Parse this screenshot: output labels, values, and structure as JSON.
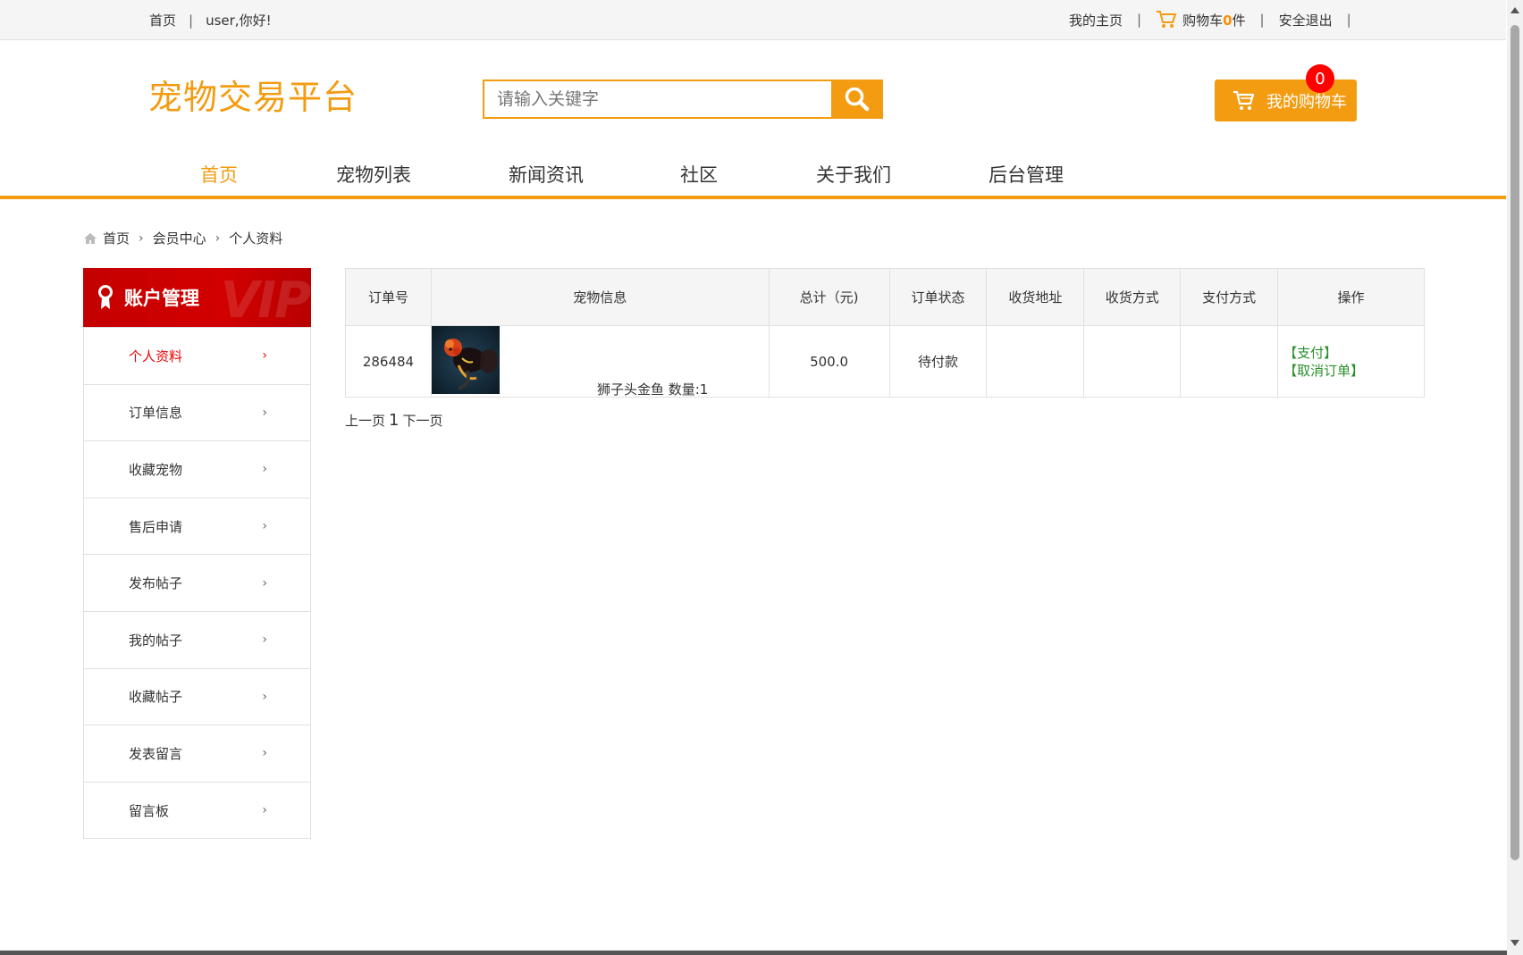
{
  "topbar": {
    "home": "首页",
    "greeting": "user,你好!",
    "my_home": "我的主页",
    "cart_prefix": "购物车",
    "cart_count": "0",
    "cart_suffix": "件",
    "logout": "安全退出",
    "sep": "|"
  },
  "header": {
    "logo": "宠物交易平台",
    "search_placeholder": "请输入关键字",
    "mycart_label": "我的购物车",
    "mycart_badge": "0"
  },
  "nav": [
    "首页",
    "宠物列表",
    "新闻资讯",
    "社区",
    "关于我们",
    "后台管理"
  ],
  "breadcrumb": [
    "首页",
    "会员中心",
    "个人资料"
  ],
  "sidebar": {
    "title": "账户管理",
    "watermark": "VIP",
    "items": [
      "个人资料",
      "订单信息",
      "收藏宠物",
      "售后申请",
      "发布帖子",
      "我的帖子",
      "收藏帖子",
      "发表留言",
      "留言板"
    ]
  },
  "orders": {
    "headers": [
      "订单号",
      "宠物信息",
      "总计（元)",
      "订单状态",
      "收货地址",
      "收货方式",
      "支付方式",
      "操作"
    ],
    "rows": [
      {
        "order_no": "286484",
        "pet_info": "狮子头金鱼 数量:1",
        "total": "500.0",
        "status": "待付款",
        "address": "",
        "delivery": "",
        "payment": "",
        "op_pay": "【支付】",
        "op_cancel": "【取消订单】"
      }
    ]
  },
  "pager": {
    "prev": "上一页",
    "page": "1",
    "next": "下一页"
  },
  "colors": {
    "accent": "#f39c12",
    "sidebar_red": "#c40000",
    "active_red": "#ee0000",
    "op_green": "#2a8f2a"
  }
}
